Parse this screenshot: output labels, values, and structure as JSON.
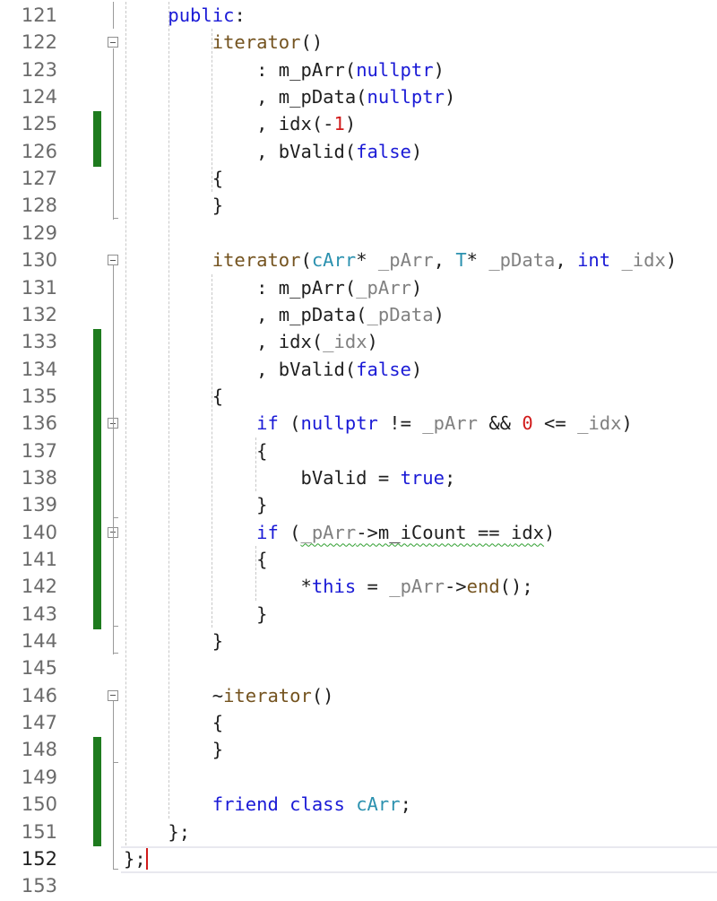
{
  "editor": {
    "current_line": 152,
    "lines": [
      {
        "n": "121",
        "code": [
          {
            "t": "    "
          },
          {
            "t": "public",
            "c": "kw"
          },
          {
            "t": ":"
          }
        ]
      },
      {
        "n": "122",
        "code": [
          {
            "t": "        "
          },
          {
            "t": "iterator",
            "c": "fn"
          },
          {
            "t": "()"
          }
        ]
      },
      {
        "n": "123",
        "code": [
          {
            "t": "            : m_pArr("
          },
          {
            "t": "nullptr",
            "c": "kw"
          },
          {
            "t": ")"
          }
        ]
      },
      {
        "n": "124",
        "code": [
          {
            "t": "            , m_pData("
          },
          {
            "t": "nullptr",
            "c": "kw"
          },
          {
            "t": ")"
          }
        ]
      },
      {
        "n": "125",
        "code": [
          {
            "t": "            , idx(-"
          },
          {
            "t": "1",
            "c": "num"
          },
          {
            "t": ")"
          }
        ]
      },
      {
        "n": "126",
        "code": [
          {
            "t": "            , bValid("
          },
          {
            "t": "false",
            "c": "kw"
          },
          {
            "t": ")"
          }
        ]
      },
      {
        "n": "127",
        "code": [
          {
            "t": "        {"
          }
        ]
      },
      {
        "n": "128",
        "code": [
          {
            "t": "        }"
          }
        ]
      },
      {
        "n": "129",
        "code": []
      },
      {
        "n": "130",
        "code": [
          {
            "t": "        "
          },
          {
            "t": "iterator",
            "c": "fn"
          },
          {
            "t": "("
          },
          {
            "t": "cArr",
            "c": "ty"
          },
          {
            "t": "* "
          },
          {
            "t": "_pArr",
            "c": "prm"
          },
          {
            "t": ", "
          },
          {
            "t": "T",
            "c": "ty"
          },
          {
            "t": "* "
          },
          {
            "t": "_pData",
            "c": "prm"
          },
          {
            "t": ", "
          },
          {
            "t": "int",
            "c": "kw"
          },
          {
            "t": " "
          },
          {
            "t": "_idx",
            "c": "prm"
          },
          {
            "t": ")"
          }
        ]
      },
      {
        "n": "131",
        "code": [
          {
            "t": "            : m_pArr("
          },
          {
            "t": "_pArr",
            "c": "prm"
          },
          {
            "t": ")"
          }
        ]
      },
      {
        "n": "132",
        "code": [
          {
            "t": "            , m_pData("
          },
          {
            "t": "_pData",
            "c": "prm"
          },
          {
            "t": ")"
          }
        ]
      },
      {
        "n": "133",
        "code": [
          {
            "t": "            , idx("
          },
          {
            "t": "_idx",
            "c": "prm"
          },
          {
            "t": ")"
          }
        ]
      },
      {
        "n": "134",
        "code": [
          {
            "t": "            , bValid("
          },
          {
            "t": "false",
            "c": "kw"
          },
          {
            "t": ")"
          }
        ]
      },
      {
        "n": "135",
        "code": [
          {
            "t": "        {"
          }
        ]
      },
      {
        "n": "136",
        "code": [
          {
            "t": "            "
          },
          {
            "t": "if",
            "c": "kw"
          },
          {
            "t": " ("
          },
          {
            "t": "nullptr",
            "c": "kw"
          },
          {
            "t": " != "
          },
          {
            "t": "_pArr",
            "c": "prm"
          },
          {
            "t": " && "
          },
          {
            "t": "0",
            "c": "num"
          },
          {
            "t": " <= "
          },
          {
            "t": "_idx",
            "c": "prm"
          },
          {
            "t": ")"
          }
        ]
      },
      {
        "n": "137",
        "code": [
          {
            "t": "            {"
          }
        ]
      },
      {
        "n": "138",
        "code": [
          {
            "t": "                bValid = "
          },
          {
            "t": "true",
            "c": "kw"
          },
          {
            "t": ";"
          }
        ]
      },
      {
        "n": "139",
        "code": [
          {
            "t": "            }"
          }
        ]
      },
      {
        "n": "140",
        "code": [
          {
            "t": "            "
          },
          {
            "t": "if",
            "c": "kw"
          },
          {
            "t": " ("
          },
          {
            "t": "_pArr",
            "c": "prm squig"
          },
          {
            "t": "->m_iCount == ",
            "c": "squig"
          },
          {
            "t": "idx",
            "c": "squig"
          },
          {
            "t": ")"
          }
        ]
      },
      {
        "n": "141",
        "code": [
          {
            "t": "            {"
          }
        ]
      },
      {
        "n": "142",
        "code": [
          {
            "t": "                *"
          },
          {
            "t": "this",
            "c": "kw"
          },
          {
            "t": " = "
          },
          {
            "t": "_pArr",
            "c": "prm"
          },
          {
            "t": "->"
          },
          {
            "t": "end",
            "c": "fn"
          },
          {
            "t": "();"
          }
        ]
      },
      {
        "n": "143",
        "code": [
          {
            "t": "            }"
          }
        ]
      },
      {
        "n": "144",
        "code": [
          {
            "t": "        }"
          }
        ]
      },
      {
        "n": "145",
        "code": []
      },
      {
        "n": "146",
        "code": [
          {
            "t": "        ~"
          },
          {
            "t": "iterator",
            "c": "fn"
          },
          {
            "t": "()"
          }
        ]
      },
      {
        "n": "147",
        "code": [
          {
            "t": "        {"
          }
        ]
      },
      {
        "n": "148",
        "code": [
          {
            "t": "        }"
          }
        ]
      },
      {
        "n": "149",
        "code": []
      },
      {
        "n": "150",
        "code": [
          {
            "t": "        "
          },
          {
            "t": "friend",
            "c": "kw"
          },
          {
            "t": " "
          },
          {
            "t": "class",
            "c": "kw"
          },
          {
            "t": " "
          },
          {
            "t": "cArr",
            "c": "ty"
          },
          {
            "t": ";"
          }
        ]
      },
      {
        "n": "151",
        "code": [
          {
            "t": "    };"
          }
        ]
      },
      {
        "n": "152",
        "code": [
          {
            "t": "};"
          }
        ]
      },
      {
        "n": "153",
        "code": []
      }
    ],
    "changed_lines": [
      "125",
      "126",
      "133",
      "134",
      "135",
      "136",
      "137",
      "138",
      "139",
      "140",
      "141",
      "142",
      "143",
      "148",
      "149",
      "150",
      "151"
    ],
    "fold_markers": [
      "122",
      "130",
      "136",
      "140",
      "146"
    ],
    "colors": {
      "keyword": "#1a1ad6",
      "type": "#2b91af",
      "number": "#d11a1a",
      "function": "#74531f",
      "parameter": "#808080",
      "change_bar": "#1e7b1e"
    }
  }
}
